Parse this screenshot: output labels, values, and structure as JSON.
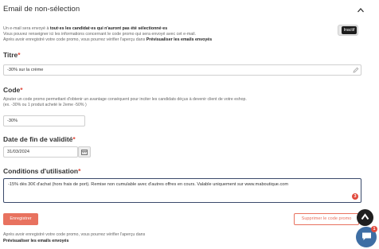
{
  "section": {
    "title": "Email de non-sélection",
    "desc_line1_prefix": "Un e-mail sera envoyé à ",
    "desc_line1_bold": "tout·es les candidat·es qui n'auront pas été sélectionné·es",
    "desc_line2": "Vous pouvez renseigner ici les informations concernant le code promo qui sera envoyé avec cet e-mail.",
    "desc_line3_prefix": "Après avoir enregistré votre code promo, vous pourrez vérifier l'aperçu dans ",
    "desc_line3_bold": "Prévisualiser les emails envoyés",
    "toggle_label": "Inactif"
  },
  "titre": {
    "label": "Titre",
    "value": "-30% sur la crème"
  },
  "code": {
    "label": "Code",
    "help_line1": "Ajouter un code promo permettant d'obtenir un avantage conséquent pour inciter les candidats déçus à devenir client de votre eshop.",
    "help_line2": "(ex. -30% ou 1 produit acheté le 2eme -50% )",
    "value": "-30%"
  },
  "date": {
    "label": "Date de fin de validité",
    "value": "31/03/2024"
  },
  "conditions": {
    "label": "Conditions d'utilisation",
    "value": "-15% dès 30€ d'achat (hors frais de port). Remise non cumulable avec d'autres offres en cours. Valable uniquement sur www.maboutique.com",
    "error_count": "3"
  },
  "actions": {
    "save_label": "Enregistrer",
    "delete_label": "Supprimer le code promo"
  },
  "footer": {
    "note_line1": "Après avoir enregistré votre code promo, vous pourrez vérifier l'aperçu dans",
    "note_line2": "Prévisualiser les emails envoyés"
  },
  "chat": {
    "badge": "1"
  },
  "colors": {
    "accent": "#e8725f",
    "required": "#e14a3d",
    "focus_border": "#3a4a6b",
    "chat": "#3e6ea4"
  },
  "icons": {
    "collapse": "chevron-up-icon",
    "edit": "edit-icon",
    "calendar": "calendar-icon",
    "scroll_top": "chevron-up-icon",
    "chat": "chat-icon"
  }
}
